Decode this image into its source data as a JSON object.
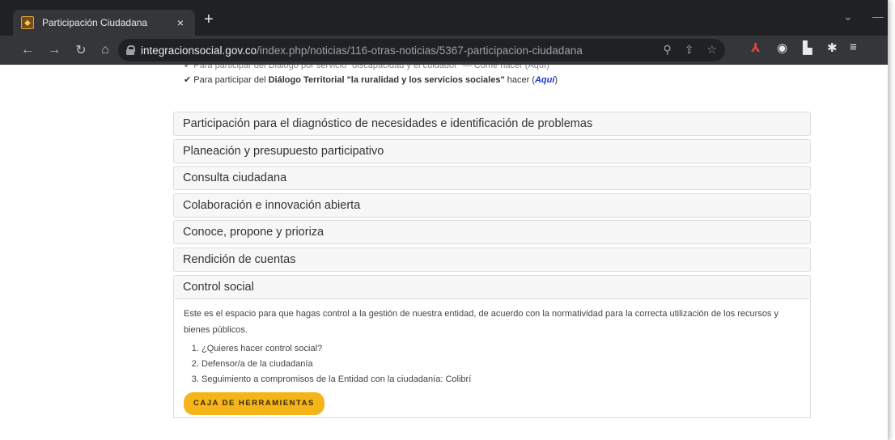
{
  "browser": {
    "tab_title": "Participación Ciudadana",
    "tab_close": "×",
    "new_tab": "+",
    "url_host": "integracionsocial.gov.co",
    "url_path": "/index.php/noticias/116-otras-noticias/5367-participacion-ciudadana",
    "minimize": "—",
    "dropdown": "⌄"
  },
  "page": {
    "cut_line": "✔ Para participar del Diálogo por servicio \"discapacidad y el cuidador\" — Come  hacer (Aquí)",
    "line2_prefix": "✔ Para participar del ",
    "line2_bold": "Diálogo Territorial \"la ruralidad y los servicios sociales\"",
    "line2_mid": "  hacer (",
    "line2_link": "Aquí",
    "line2_suffix": ")",
    "accordion": [
      "Participación para el diagnóstico de necesidades e identificación de problemas",
      "Planeación y presupuesto participativo",
      "Consulta ciudadana",
      "Colaboración e innovación abierta",
      "Conoce, propone y prioriza",
      "Rendición de cuentas",
      "Control social"
    ],
    "open_text": "Este es el espacio para que hagas control a la gestión de nuestra entidad, de acuerdo con la normatividad para la correcta utilización de los recursos y bienes públicos.",
    "open_list": [
      "¿Quieres hacer control social?",
      "Defensor/a de la ciudadanía",
      "Seguimiento a compromisos de la Entidad con la ciudadanía: Colibrí"
    ],
    "button_label": "CAJA DE HERRAMIENTAS"
  },
  "colors": {
    "button": "#f5b51a",
    "link": "#1a35d8",
    "chrome_dark": "#202124",
    "chrome_toolbar": "#35363a"
  }
}
